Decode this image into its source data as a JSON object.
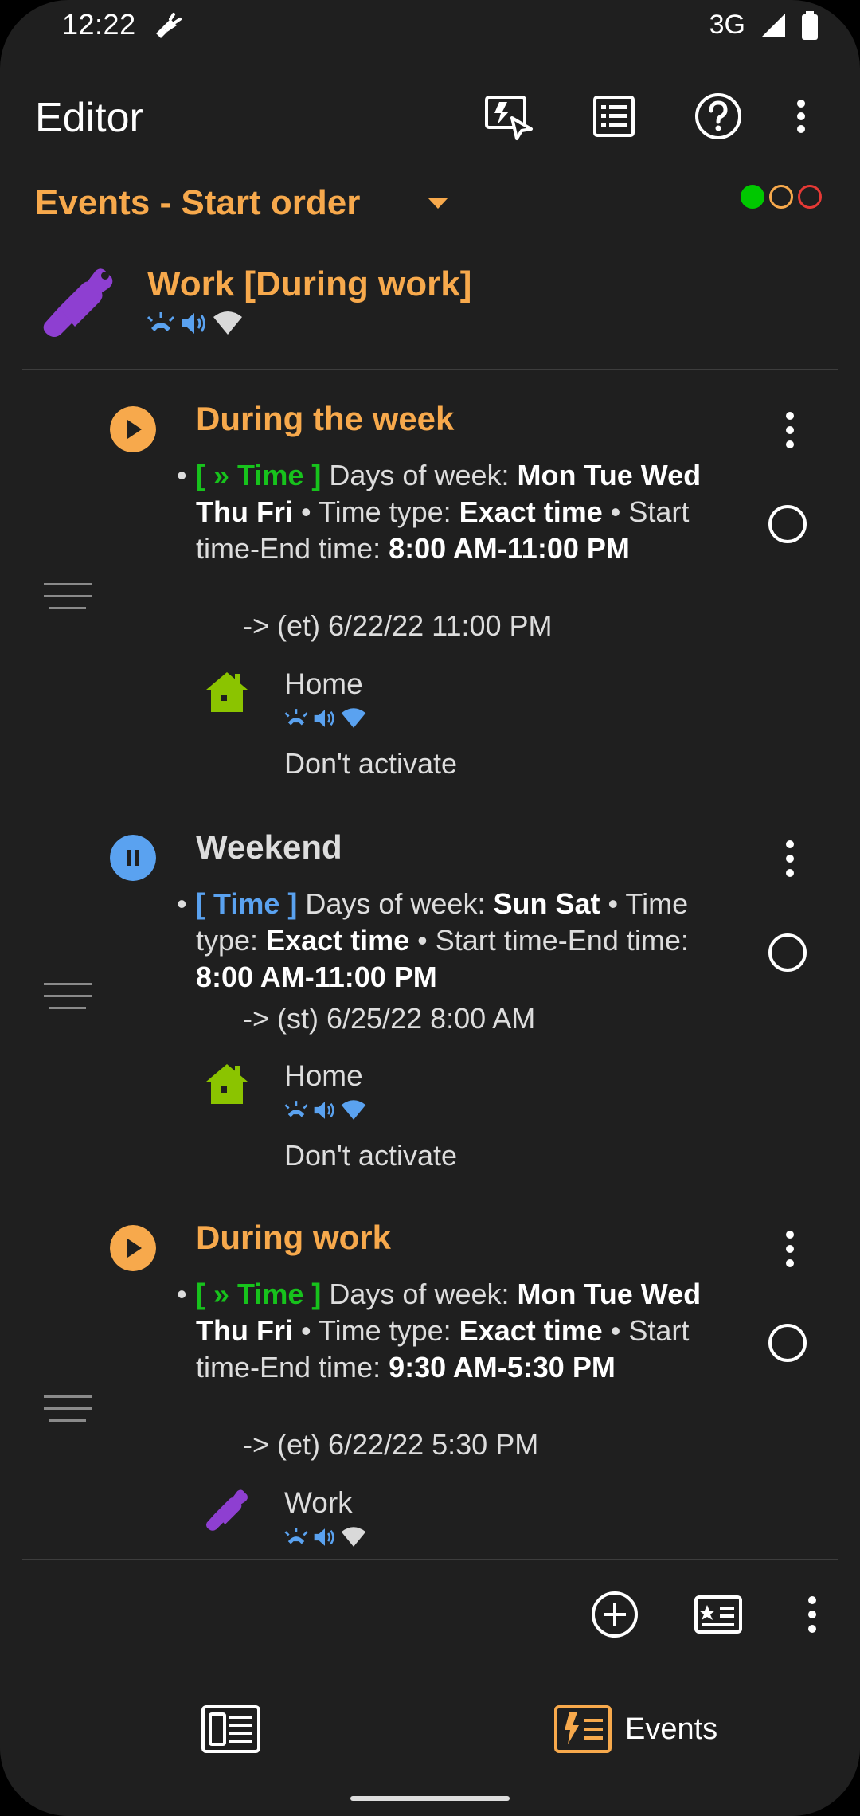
{
  "status": {
    "time": "12:22",
    "network": "3G"
  },
  "appbar": {
    "title": "Editor"
  },
  "subheader": {
    "title": "Events - Start order",
    "status_colors": [
      "#00c800",
      "#f7a94c",
      "#e53935"
    ]
  },
  "profile": {
    "name": "Work [During work]"
  },
  "events": [
    {
      "name": "During the week",
      "state": "running",
      "tag": "[ » Time ]",
      "desc_parts": {
        "p1": " Days of week: ",
        "b1": "Mon Tue Wed Thu Fri",
        "p2": " • Time type: ",
        "b2": "Exact time",
        "p3": " • Start time-End time: ",
        "b3": "8:00 AM-11:00 PM"
      },
      "arrow": "-> (et) 6/22/22 11:00 PM",
      "sub_profile": {
        "name": "Home",
        "note": "Don't activate"
      }
    },
    {
      "name": "Weekend",
      "state": "paused",
      "tag": "[ Time ]",
      "desc_parts": {
        "p1": " Days of week: ",
        "b1": "Sun Sat",
        "p2": " • Time type: ",
        "b2": "Exact time",
        "p3": " • Start time-End time: ",
        "b3": "8:00 AM-11:00 PM"
      },
      "arrow": "-> (st) 6/25/22 8:00 AM",
      "sub_profile": {
        "name": "Home",
        "note": "Don't activate"
      }
    },
    {
      "name": "During work",
      "state": "running",
      "tag": "[ » Time ]",
      "desc_parts": {
        "p1": " Days of week: ",
        "b1": "Mon Tue Wed Thu Fri",
        "p2": " • Time type: ",
        "b2": "Exact time",
        "p3": " • Start time-End time: ",
        "b3": "9:30 AM-5:30 PM"
      },
      "arrow": "-> (et) 6/22/22 5:30 PM",
      "sub_profile": {
        "name": "Work",
        "note": ""
      }
    }
  ],
  "nav": {
    "events_label": "Events"
  },
  "colors": {
    "accent": "#f7a94c",
    "running": "#f7a94c",
    "paused": "#5aa2f0",
    "tag_green": "#17c21c",
    "tag_blue": "#5aa2f0"
  }
}
